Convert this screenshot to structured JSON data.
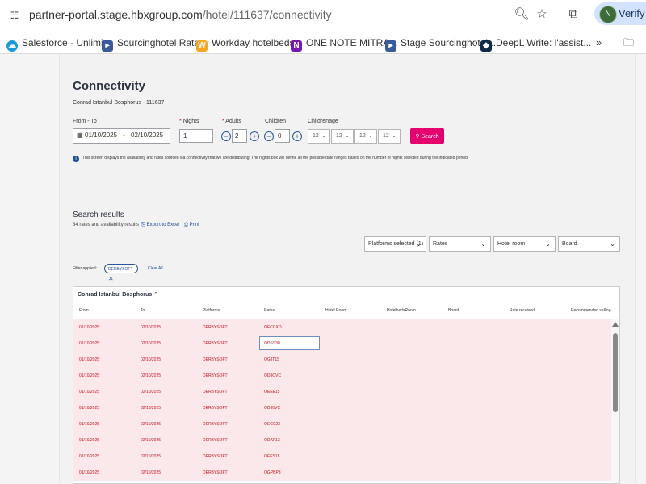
{
  "browser": {
    "url_host": "partner-portal.stage.hbxgroup.com",
    "url_path": "/hotel/111637/connectivity",
    "profile_label": "Verify it's",
    "profile_initial": "N"
  },
  "bookmarks": [
    {
      "label": "Salesforce - Unlimit...",
      "icon": "salesforce-cloud-icon",
      "color": "#1a9ad6"
    },
    {
      "label": "Sourcinghotel Rate...",
      "icon": "sourcinghotel-icon",
      "color": "#3a5a9c"
    },
    {
      "label": "Workday hotelbeds...",
      "icon": "workday-icon",
      "color": "#f5a623"
    },
    {
      "label": "ONE NOTE MITRA...",
      "icon": "onenote-icon",
      "color": "#7719aa"
    },
    {
      "label": "Stage Sourcinghotel...",
      "icon": "sourcinghotel-icon",
      "color": "#3a5a9c"
    },
    {
      "label": "DeepL Write: l'assist...",
      "icon": "deepl-icon",
      "color": "#0f2b46"
    }
  ],
  "page": {
    "title": "Connectivity",
    "hotel_line": "Conrad Istanbul Bosphorus - 111637",
    "form": {
      "from_to_label": "From - To",
      "from_date": "01/10/2025",
      "date_separator": "-",
      "to_date": "02/10/2025",
      "nights_label": "Nights",
      "nights_value": "1",
      "adults_label": "Adults",
      "adults_value": "2",
      "children_label": "Children",
      "children_value": "0",
      "children_age_label": "Childrenage",
      "children_ages": [
        "12",
        "12",
        "12",
        "12"
      ],
      "search_label": "Search"
    },
    "info_text": "This screen displays the availability and rates sourced via connectivity that we are distributing. The nights box will define all the possible date ranges based on the number of nights selected during the indicated period.",
    "results": {
      "title": "Search results",
      "count_text": "34 rates and availability results",
      "export_label": "Export to Excel",
      "print_label": "Print",
      "filters": {
        "platforms": "Platforms selected (1)",
        "rates": "Rates",
        "hotel_room": "Hotel room",
        "board": "Board"
      },
      "filter_applied_label": "Filter applied:",
      "chip_label": "DERBYSOFT",
      "clear_all": "Clear All",
      "group_title": "Conrad Istanbul Bosphorus",
      "columns": [
        "From",
        "To",
        "Platforms",
        "Rates",
        "Hotel Room",
        "HotelbedsRoom",
        "Board",
        "Rate received",
        "Recommended selling price"
      ],
      "rows": [
        {
          "from": "01/10/2025",
          "to": "02/10/2025",
          "platform": "DERBYSOFT",
          "rate": "OECCXO"
        },
        {
          "from": "01/10/2025",
          "to": "02/10/2025",
          "platform": "DERBYSOFT",
          "rate": "ODSS30"
        },
        {
          "from": "01/10/2025",
          "to": "02/10/2025",
          "platform": "DERBYSOFT",
          "rate": "OGJT15"
        },
        {
          "from": "01/10/2025",
          "to": "02/10/2025",
          "platform": "DERBYSOFT",
          "rate": "OD3OVC"
        },
        {
          "from": "01/10/2025",
          "to": "02/10/2025",
          "platform": "DERBYSOFT",
          "rate": "OEEE15"
        },
        {
          "from": "01/10/2025",
          "to": "02/10/2025",
          "platform": "DERBYSOFT",
          "rate": "OD30VC"
        },
        {
          "from": "01/10/2025",
          "to": "02/10/2025",
          "platform": "DERBYSOFT",
          "rate": "OECC23"
        },
        {
          "from": "01/10/2025",
          "to": "02/10/2025",
          "platform": "DERBYSOFT",
          "rate": "ODAP13"
        },
        {
          "from": "01/10/2025",
          "to": "02/10/2025",
          "platform": "DERBYSOFT",
          "rate": "OEES18"
        },
        {
          "from": "01/10/2025",
          "to": "02/10/2025",
          "platform": "DERBYSOFT",
          "rate": "OGPBP3"
        }
      ]
    }
  }
}
